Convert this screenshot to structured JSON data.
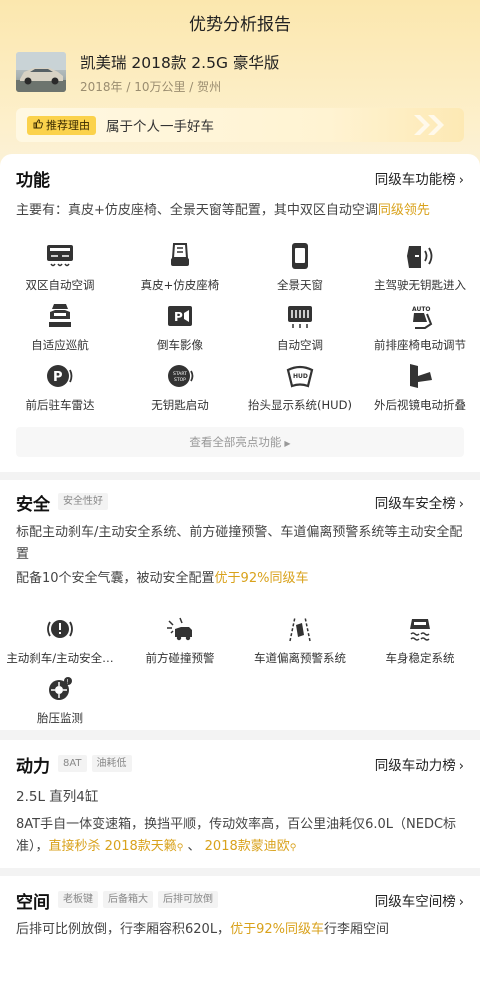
{
  "page": {
    "title": "优势分析报告"
  },
  "car": {
    "name": "凯美瑞 2018款 2.5G 豪华版",
    "meta": "2018年 / 10万公里 / 贺州"
  },
  "reason": {
    "chip_label": "推荐理由",
    "text": "属于个人一手好车"
  },
  "features": {
    "title": "功能",
    "rank_label": "同级车功能榜",
    "summary_prefix": "主要有：真皮+仿皮座椅、全景天窗等配置，其中双区自动空调",
    "summary_highlight": "同级领先",
    "items": [
      {
        "label": "双区自动空调",
        "icon": "dual-zone-ac-icon"
      },
      {
        "label": "真皮+仿皮座椅",
        "icon": "leather-seat-icon"
      },
      {
        "label": "全景天窗",
        "icon": "panoramic-sunroof-icon"
      },
      {
        "label": "主驾驶无钥匙进入",
        "icon": "keyless-entry-icon"
      },
      {
        "label": "自适应巡航",
        "icon": "adaptive-cruise-icon"
      },
      {
        "label": "倒车影像",
        "icon": "reverse-camera-icon"
      },
      {
        "label": "自动空调",
        "icon": "auto-ac-icon"
      },
      {
        "label": "前排座椅电动调节",
        "icon": "power-seat-icon"
      },
      {
        "label": "前后驻车雷达",
        "icon": "parking-radar-icon"
      },
      {
        "label": "无钥匙启动",
        "icon": "keyless-start-icon"
      },
      {
        "label": "抬头显示系统(HUD)",
        "icon": "hud-icon"
      },
      {
        "label": "外后视镜电动折叠",
        "icon": "mirror-fold-icon"
      }
    ],
    "more_label": "查看全部亮点功能"
  },
  "safety": {
    "title": "安全",
    "tags": [
      "安全性好"
    ],
    "rank_label": "同级车安全榜",
    "para1": "标配主动刹车/主动安全系统、前方碰撞预警、车道偏离预警系统等主动安全配置",
    "para2_prefix": "配备10个安全气囊，被动安全配置",
    "para2_highlight": "优于92%同级车",
    "items": [
      {
        "label": "主动刹车/主动安全…",
        "icon": "active-brake-icon"
      },
      {
        "label": "前方碰撞预警",
        "icon": "collision-warning-icon"
      },
      {
        "label": "车道偏离预警系统",
        "icon": "lane-departure-icon"
      },
      {
        "label": "车身稳定系统",
        "icon": "stability-control-icon"
      },
      {
        "label": "胎压监测",
        "icon": "tire-pressure-icon"
      }
    ]
  },
  "power": {
    "title": "动力",
    "tags": [
      "8AT",
      "油耗低"
    ],
    "rank_label": "同级车动力榜",
    "engine": "2.5L 直列4缸",
    "desc": "8AT手自一体变速箱，换挡平顺，传动效率高，百公里油耗仅6.0L（NEDC标准），",
    "link_prefix": "直接秒杀",
    "link1": "2018款天籁",
    "sep": "、",
    "link2": "2018款蒙迪欧"
  },
  "space": {
    "title": "空间",
    "tags": [
      "老板键",
      "后备箱大",
      "后排可放倒"
    ],
    "rank_label": "同级车空间榜",
    "desc_prefix": "后排可比例放倒，行李厢容积620L，",
    "desc_highlight": "优于92%同级车",
    "desc_suffix": "行李厢空间"
  },
  "colors": {
    "accent": "#d9a21c",
    "chip": "#fbd24c"
  }
}
